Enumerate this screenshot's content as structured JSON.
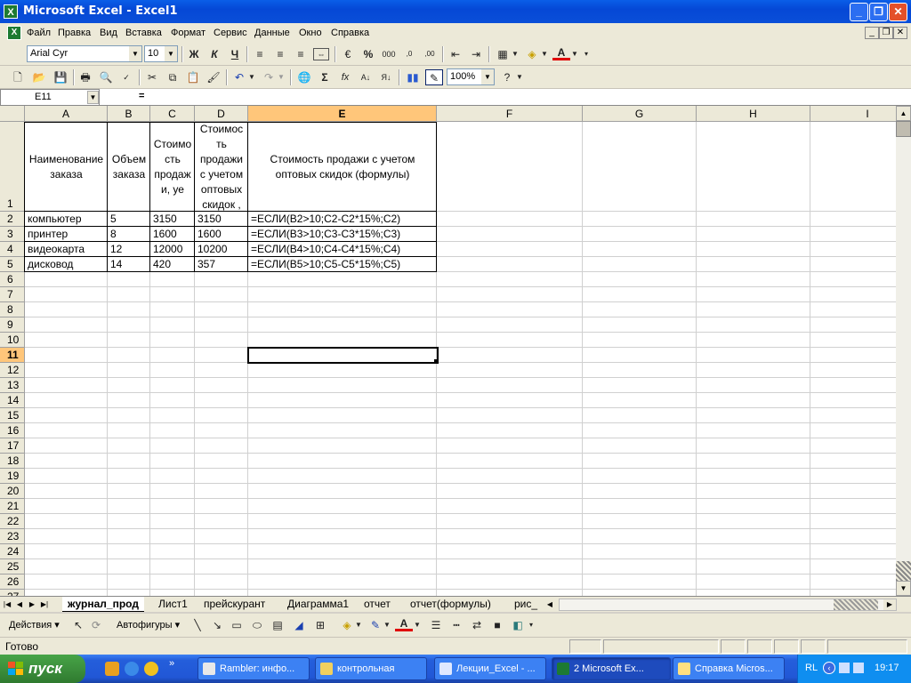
{
  "window": {
    "title": "Microsoft Excel - Excel1",
    "app_icon": "X"
  },
  "menu": [
    "Файл",
    "Правка",
    "Вид",
    "Вставка",
    "Формат",
    "Сервис",
    "Данные",
    "Окно",
    "Справка"
  ],
  "format_toolbar": {
    "font": "Arial Cyr",
    "size": "10",
    "bold": "Ж",
    "italic": "К",
    "underline": "Ч",
    "percent": "%",
    "thousands": "000"
  },
  "standard_toolbar": {
    "zoom": "100%",
    "sigma": "Σ",
    "fx": "fx"
  },
  "formula_bar": {
    "name_box": "E11",
    "equals": "=",
    "value": ""
  },
  "columns": [
    "A",
    "B",
    "C",
    "D",
    "E",
    "F",
    "G",
    "H",
    "I"
  ],
  "selected_column": "E",
  "selected_row": "11",
  "rows": [
    "1",
    "2",
    "3",
    "4",
    "5",
    "6",
    "7",
    "8",
    "9",
    "10",
    "11",
    "12",
    "13",
    "14",
    "15",
    "16",
    "17",
    "18",
    "19",
    "20",
    "21",
    "22",
    "23",
    "24",
    "25",
    "26",
    "27"
  ],
  "header_row": {
    "a": [
      "Наименование",
      "заказа"
    ],
    "b": [
      "Объем",
      "заказа"
    ],
    "c": [
      "Стоимо",
      "сть",
      "продаж",
      "и, уе"
    ],
    "d": [
      "Стоимос",
      "ть",
      "продажи",
      "с учетом",
      "оптовых",
      "скидок ,"
    ],
    "e": [
      "Стоимость продажи с учетом",
      "оптовых скидок (формулы)"
    ]
  },
  "data_rows": [
    {
      "name": "компьютер",
      "qty": "5",
      "price": "3150",
      "disc": "3150",
      "formula": "=ЕСЛИ(B2>10;C2-C2*15%;C2)"
    },
    {
      "name": "принтер",
      "qty": "8",
      "price": "1600",
      "disc": "1600",
      "formula": "=ЕСЛИ(B3>10;C3-C3*15%;C3)"
    },
    {
      "name": "видеокарта",
      "qty": "12",
      "price": "12000",
      "disc": "10200",
      "formula": "=ЕСЛИ(B4>10;C4-C4*15%;C4)"
    },
    {
      "name": "дисковод",
      "qty": "14",
      "price": "420",
      "disc": "357",
      "formula": "=ЕСЛИ(B5>10;C5-C5*15%;C5)"
    }
  ],
  "sheet_tabs": [
    "журнал_прод",
    "Лист1",
    "прейскурант",
    "Диаграмма1",
    "отчет",
    "отчет(формулы)",
    "рис_"
  ],
  "draw_toolbar": {
    "actions": "Действия ▾",
    "autoshapes": "Автофигуры ▾"
  },
  "status": "Готово",
  "taskbar": {
    "start": "пуск",
    "items": [
      "Rambler: инфо...",
      "контрольная",
      "Лекции_Excel - ...",
      "2 Microsoft Ex...",
      "Справка Micros..."
    ],
    "lang": "RL",
    "clock": "19:17"
  }
}
